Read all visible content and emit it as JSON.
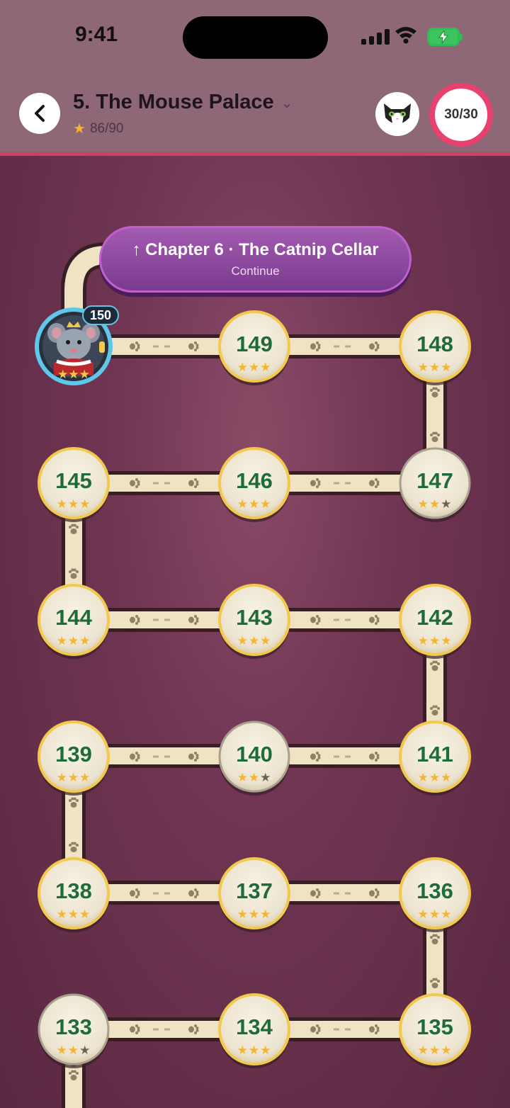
{
  "status": {
    "time": "9:41"
  },
  "header": {
    "title": "5. The Mouse Palace",
    "stars_text": "86/90",
    "energy": "30/30"
  },
  "chapter_button": {
    "label": "↑  Chapter 6 · The Catnip Cellar",
    "action": "Continue"
  },
  "current_level": {
    "number": "150",
    "name": "mouse-king-avatar"
  },
  "colors": {
    "accent": "#e8416e",
    "path": "#efe3c4",
    "node_gold": "#f2c94c",
    "level_text": "#1f6b3a"
  },
  "levels": [
    {
      "id": "149",
      "stars": 3
    },
    {
      "id": "148",
      "stars": 3
    },
    {
      "id": "145",
      "stars": 3
    },
    {
      "id": "146",
      "stars": 3
    },
    {
      "id": "147",
      "stars": 2
    },
    {
      "id": "144",
      "stars": 3
    },
    {
      "id": "143",
      "stars": 3
    },
    {
      "id": "142",
      "stars": 3
    },
    {
      "id": "139",
      "stars": 3
    },
    {
      "id": "140",
      "stars": 2
    },
    {
      "id": "141",
      "stars": 3
    },
    {
      "id": "138",
      "stars": 3
    },
    {
      "id": "137",
      "stars": 3
    },
    {
      "id": "136",
      "stars": 3
    },
    {
      "id": "133",
      "stars": 2
    },
    {
      "id": "134",
      "stars": 3
    },
    {
      "id": "135",
      "stars": 3
    }
  ]
}
